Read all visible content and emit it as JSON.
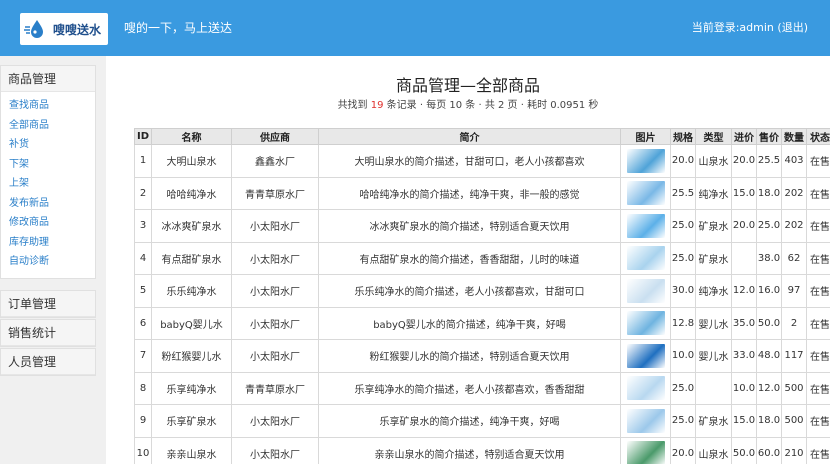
{
  "header": {
    "logo_text": "嗖嗖送水",
    "slogan": "嗖的一下，马上送达",
    "login_prefix": "当前登录:admin",
    "logout": "(退出)"
  },
  "sidebar": {
    "product": {
      "title": "商品管理",
      "items": [
        "查找商品",
        "全部商品",
        "补货",
        "下架",
        "上架",
        "发布新品",
        "修改商品",
        "库存助理",
        "自动诊断"
      ]
    },
    "order": {
      "title": "订单管理"
    },
    "sales": {
      "title": "销售统计"
    },
    "staff": {
      "title": "人员管理"
    }
  },
  "main": {
    "title": "商品管理—全部商品",
    "summary": {
      "prefix": "共找到",
      "count": "19",
      "suffix": "条记录 · 每页 10 条 · 共 2 页 · 耗时 0.0951 秒"
    },
    "table": {
      "headers": [
        "ID",
        "名称",
        "供应商",
        "简介",
        "图片",
        "规格",
        "类型",
        "进价",
        "售价",
        "数量",
        "状态"
      ],
      "rows": [
        {
          "id": "1",
          "name": "大明山泉水",
          "supplier": "鑫鑫水厂",
          "desc": "大明山泉水的简介描述，甘甜可口，老人小孩都喜欢",
          "spec": "20.0",
          "type": "山泉水",
          "cost": "20.0",
          "price": "25.5",
          "qty": "403",
          "status": "在售",
          "img_color": "#4fa3d8"
        },
        {
          "id": "2",
          "name": "哈哈纯净水",
          "supplier": "青青草原水厂",
          "desc": "哈哈纯净水的简介描述，纯净干爽，非一般的感觉",
          "spec": "25.5",
          "type": "纯净水",
          "cost": "15.0",
          "price": "18.0",
          "qty": "202",
          "status": "在售",
          "img_color": "#7ab8e6"
        },
        {
          "id": "3",
          "name": "冰冰爽矿泉水",
          "supplier": "小太阳水厂",
          "desc": "冰冰爽矿泉水的简介描述，特别适合夏天饮用",
          "spec": "25.0",
          "type": "矿泉水",
          "cost": "20.0",
          "price": "25.0",
          "qty": "202",
          "status": "在售",
          "img_color": "#5cb0e8"
        },
        {
          "id": "4",
          "name": "有点甜矿泉水",
          "supplier": "小太阳水厂",
          "desc": "有点甜矿泉水的简介描述，香香甜甜，儿时的味道",
          "spec": "25.0",
          "type": "矿泉水",
          "cost": "",
          "price": "38.0",
          "qty": "62",
          "status": "在售",
          "img_color": "#a9d3ee"
        },
        {
          "id": "5",
          "name": "乐乐纯净水",
          "supplier": "小太阳水厂",
          "desc": "乐乐纯净水的简介描述，老人小孩都喜欢，甘甜可口",
          "spec": "30.0",
          "type": "纯净水",
          "cost": "12.0",
          "price": "16.0",
          "qty": "97",
          "status": "在售",
          "img_color": "#c9dff0"
        },
        {
          "id": "6",
          "name": "babyQ婴儿水",
          "supplier": "小太阳水厂",
          "desc": "babyQ婴儿水的简介描述，纯净干爽，好喝",
          "spec": "12.8",
          "type": "婴儿水",
          "cost": "35.0",
          "price": "50.0",
          "qty": "2",
          "status": "在售",
          "img_color": "#6fb4e0"
        },
        {
          "id": "7",
          "name": "粉红猴婴儿水",
          "supplier": "小太阳水厂",
          "desc": "粉红猴婴儿水的简介描述，特别适合夏天饮用",
          "spec": "10.0",
          "type": "婴儿水",
          "cost": "33.0",
          "price": "48.0",
          "qty": "117",
          "status": "在售",
          "img_color": "#1f6fc0"
        },
        {
          "id": "8",
          "name": "乐享纯净水",
          "supplier": "青青草原水厂",
          "desc": "乐享纯净水的简介描述，老人小孩都喜欢，香香甜甜",
          "spec": "25.0",
          "type": "",
          "cost": "10.0",
          "price": "12.0",
          "qty": "500",
          "status": "在售",
          "img_color": "#b8d8f0"
        },
        {
          "id": "9",
          "name": "乐享矿泉水",
          "supplier": "小太阳水厂",
          "desc": "乐享矿泉水的简介描述，纯净干爽，好喝",
          "spec": "25.0",
          "type": "矿泉水",
          "cost": "15.0",
          "price": "18.0",
          "qty": "500",
          "status": "在售",
          "img_color": "#9cc8ea"
        },
        {
          "id": "10",
          "name": "亲亲山泉水",
          "supplier": "小太阳水厂",
          "desc": "亲亲山泉水的简介描述，特别适合夏天饮用",
          "spec": "20.0",
          "type": "山泉水",
          "cost": "50.0",
          "price": "60.0",
          "qty": "210",
          "status": "在售",
          "img_color": "#4a9a6a"
        }
      ]
    }
  }
}
